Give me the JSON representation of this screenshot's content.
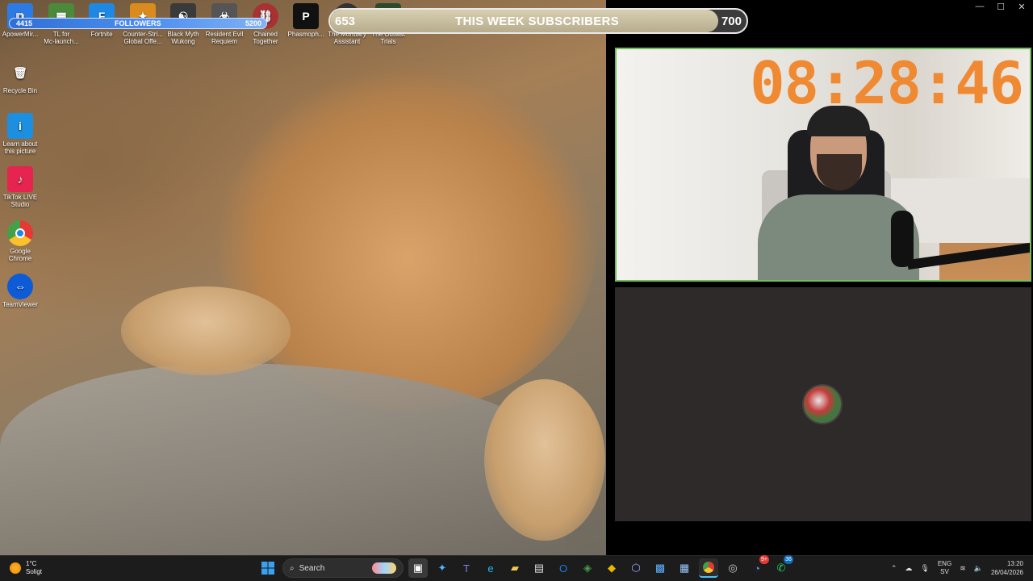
{
  "overlay": {
    "followers": {
      "current": "4415",
      "label": "FOLLOWERS",
      "goal": "5200",
      "progress_fraction": 0.849
    },
    "subscribers": {
      "current": "653",
      "label": "THIS WEEK SUBSCRIBERS",
      "goal": "700",
      "progress_fraction": 0.933
    },
    "timer": "08:28:46",
    "timer_color": "#f08a32"
  },
  "desktop_icons": {
    "apower": "ApowerMir...",
    "tl": "TL for\nMc-launch...",
    "fortnite": "Fortnite",
    "cs": "Counter-Stri...\nGlobal Offe...",
    "blackmyth": "Black Myth\nWukong",
    "re": "Resident Evil\nRequiem",
    "chained": "Chained\nTogether",
    "phasmo": "Phasmoph...",
    "mortuary": "The Mortuary\nAssistant",
    "outlast": "The Outlast\nTrials",
    "recycle": "Recycle Bin",
    "learn": "Learn about\nthis picture",
    "tiktok": "TikTok LIVE\nStudio",
    "chrome": "Google\nChrome",
    "teamviewer": "TeamViewer"
  },
  "taskbar": {
    "weather_temp": "1°C",
    "weather_desc": "Soligt",
    "search_label": "Search",
    "lang_top": "ENG",
    "lang_bottom": "SV",
    "time": "13:20",
    "date": "26/04/2026",
    "discord_badge": "9+",
    "whatsapp_badge": "36"
  },
  "window_controls": {
    "minimize": "—",
    "maximize": "☐",
    "close": "✕"
  }
}
